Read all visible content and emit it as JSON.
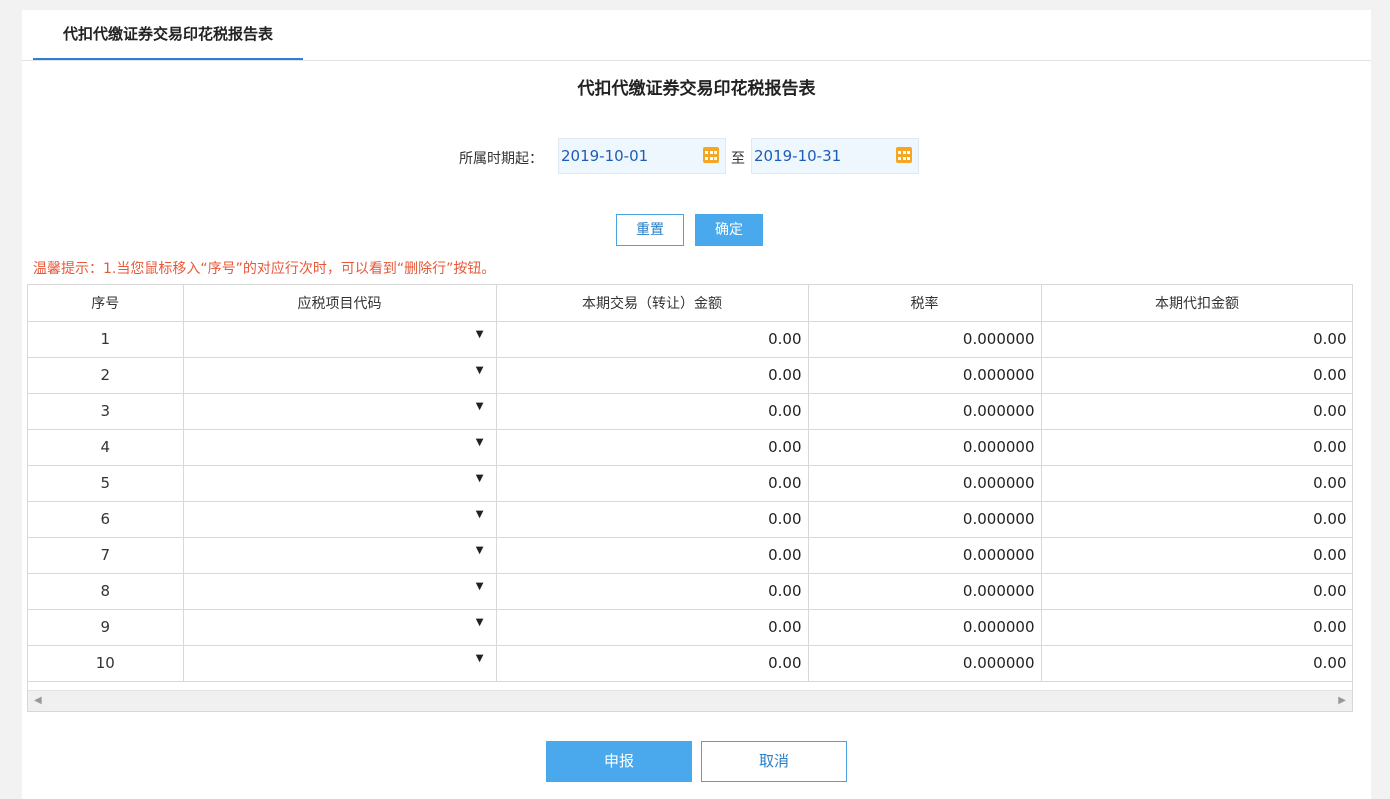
{
  "tab": {
    "label": "代扣代缴证券交易印花税报告表"
  },
  "page_title": "代扣代缴证券交易印花税报告表",
  "period": {
    "label": "所属时期起：",
    "start": "2019-10-01",
    "to_label": "至",
    "end": "2019-10-31"
  },
  "buttons": {
    "reset": "重置",
    "confirm": "确定",
    "submit": "申报",
    "cancel": "取消"
  },
  "tip": "温馨提示：1.当您鼠标移入“序号”的对应行次时，可以看到“删除行”按钮。",
  "table": {
    "headers": [
      "序号",
      "应税项目代码",
      "本期交易（转让）金额",
      "税率",
      "本期代扣金额"
    ],
    "rows": [
      {
        "seq": "1",
        "code": "",
        "amount": "0.00",
        "rate": "0.000000",
        "withheld": "0.00"
      },
      {
        "seq": "2",
        "code": "",
        "amount": "0.00",
        "rate": "0.000000",
        "withheld": "0.00"
      },
      {
        "seq": "3",
        "code": "",
        "amount": "0.00",
        "rate": "0.000000",
        "withheld": "0.00"
      },
      {
        "seq": "4",
        "code": "",
        "amount": "0.00",
        "rate": "0.000000",
        "withheld": "0.00"
      },
      {
        "seq": "5",
        "code": "",
        "amount": "0.00",
        "rate": "0.000000",
        "withheld": "0.00"
      },
      {
        "seq": "6",
        "code": "",
        "amount": "0.00",
        "rate": "0.000000",
        "withheld": "0.00"
      },
      {
        "seq": "7",
        "code": "",
        "amount": "0.00",
        "rate": "0.000000",
        "withheld": "0.00"
      },
      {
        "seq": "8",
        "code": "",
        "amount": "0.00",
        "rate": "0.000000",
        "withheld": "0.00"
      },
      {
        "seq": "9",
        "code": "",
        "amount": "0.00",
        "rate": "0.000000",
        "withheld": "0.00"
      },
      {
        "seq": "10",
        "code": "",
        "amount": "0.00",
        "rate": "0.000000",
        "withheld": "0.00"
      }
    ]
  },
  "colors": {
    "accent": "#4aa8ec",
    "tab_underline": "#2f7fd6",
    "tip": "#e8593a",
    "date_text": "#1d5db5"
  },
  "icons": {
    "calendar": "calendar-icon",
    "dropdown": "dropdown-arrow-icon",
    "scroll_left": "scroll-left-icon",
    "scroll_right": "scroll-right-icon"
  }
}
